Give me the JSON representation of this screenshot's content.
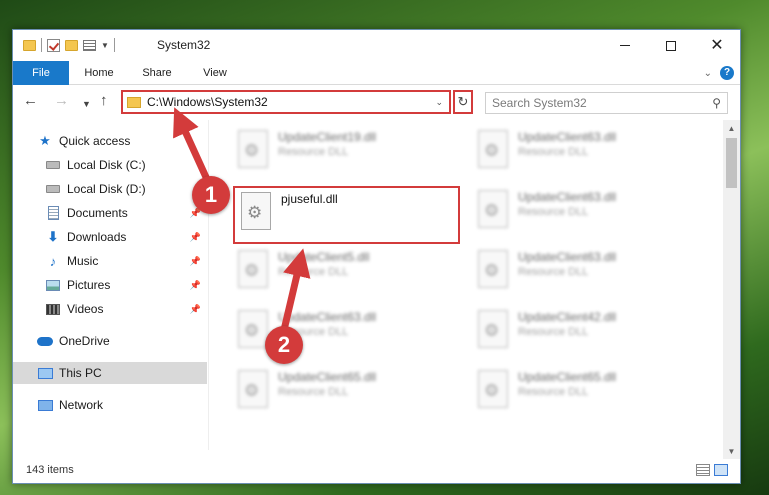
{
  "window": {
    "title": "System32",
    "controls": {
      "minimize": "minimize-icon",
      "maximize": "maximize-icon",
      "close": "close-icon"
    }
  },
  "ribbon": {
    "tabs": [
      "File",
      "Home",
      "Share",
      "View"
    ]
  },
  "navigation": {
    "address": "C:\\Windows\\System32",
    "search_placeholder": "Search System32"
  },
  "sidebar": {
    "items": [
      {
        "label": "Quick access",
        "icon": "star-icon",
        "pinned": false
      },
      {
        "label": "Local Disk (C:)",
        "icon": "drive-icon",
        "pinned": false
      },
      {
        "label": "Local Disk (D:)",
        "icon": "drive-icon",
        "pinned": false
      },
      {
        "label": "Documents",
        "icon": "documents-icon",
        "pinned": true
      },
      {
        "label": "Downloads",
        "icon": "download-icon",
        "pinned": true
      },
      {
        "label": "Music",
        "icon": "music-icon",
        "pinned": true
      },
      {
        "label": "Pictures",
        "icon": "pictures-icon",
        "pinned": true
      },
      {
        "label": "Videos",
        "icon": "videos-icon",
        "pinned": true
      },
      {
        "label": "OneDrive",
        "icon": "cloud-icon",
        "pinned": false
      },
      {
        "label": "This PC",
        "icon": "computer-icon",
        "pinned": false,
        "selected": true
      },
      {
        "label": "Network",
        "icon": "network-icon",
        "pinned": false
      }
    ]
  },
  "files": {
    "col1": [
      {
        "name": "UpdateClient19.dll",
        "type": "Resource DLL"
      },
      {
        "name": "UpdateClient5.dll",
        "type": "Resource DLL"
      },
      {
        "name": "UpdateClient63.dll",
        "type": "Resource DLL"
      },
      {
        "name": "UpdateClient65.dll",
        "type": "Resource DLL"
      }
    ],
    "col2": [
      {
        "name": "UpdateClient63.dll",
        "type": "Resource DLL"
      },
      {
        "name": "UpdateClient63.dll",
        "type": "Resource DLL"
      },
      {
        "name": "UpdateClient63.dll",
        "type": "Resource DLL"
      },
      {
        "name": "UpdateClient42.dll",
        "type": "Resource DLL"
      },
      {
        "name": "UpdateClient65.dll",
        "type": "Resource DLL"
      }
    ],
    "highlighted": {
      "name": "pjuseful.dll"
    }
  },
  "status": {
    "count": "143 items"
  },
  "annotations": {
    "step1": "1",
    "step2": "2",
    "color": "#d33b3b"
  }
}
